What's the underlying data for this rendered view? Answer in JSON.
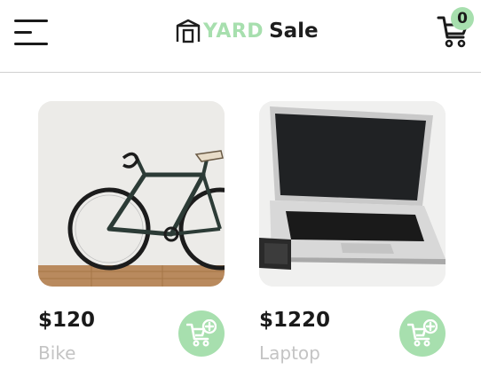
{
  "header": {
    "logo_part1": "YARD",
    "logo_part2": "Sale",
    "cart_count": "0"
  },
  "colors": {
    "accent": "#a7dfae",
    "text_dark": "#1a1a1a",
    "text_muted": "#c4c4c4"
  },
  "icons": [
    "menu-icon",
    "storefront-icon",
    "cart-icon",
    "add-to-cart-icon"
  ],
  "products": [
    {
      "price": "$120",
      "name": "Bike"
    },
    {
      "price": "$1220",
      "name": "Laptop"
    }
  ]
}
